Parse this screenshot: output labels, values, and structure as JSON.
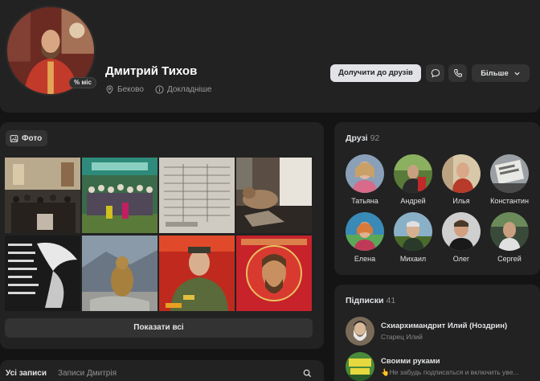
{
  "profile": {
    "name": "Дмитрий Тихов",
    "badge": "% міс",
    "location": "Беково",
    "details": "Докладніше"
  },
  "actions": {
    "add_friend": "Долучити до друзів",
    "more": "Більше"
  },
  "photos": {
    "tab_label": "Фото",
    "show_all": "Показати всі"
  },
  "wall": {
    "tab_all": "Усі записи",
    "tab_owner": "Записи Дмитрія"
  },
  "friends": {
    "title": "Друзі",
    "count": "92",
    "items": [
      {
        "name": "Татьяна"
      },
      {
        "name": "Андрей"
      },
      {
        "name": "Илья"
      },
      {
        "name": "Константин"
      },
      {
        "name": "Елена"
      },
      {
        "name": "Михаил"
      },
      {
        "name": "Олег"
      },
      {
        "name": "Сергей"
      }
    ]
  },
  "subscriptions": {
    "title": "Підписки",
    "count": "41",
    "items": [
      {
        "title": "Схиархимандрит Илий (Ноздрин)",
        "subtitle": "Старец Илий"
      },
      {
        "title": "Своими руками",
        "subtitle": "👆Не забудь подписаться и включить уве..."
      }
    ]
  },
  "colors": {
    "background": "#141414",
    "panel": "#222222",
    "button": "#333333",
    "primary_button": "#e1e3e6",
    "muted_text": "#939393"
  }
}
